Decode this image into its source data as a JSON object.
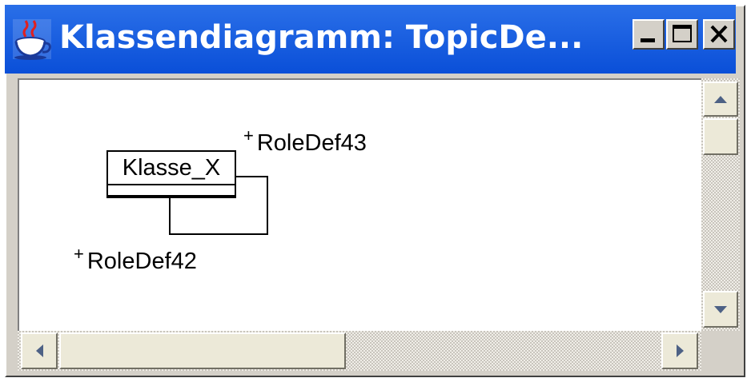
{
  "window": {
    "title": "Klassendiagramm: TopicDe...",
    "app_icon": "java-coffee-cup-icon",
    "controls": [
      "minimize-icon",
      "maximize-icon",
      "close-icon"
    ]
  },
  "diagram": {
    "class": {
      "name": "Klasse_X"
    },
    "roles": [
      {
        "plus": "+",
        "name": "RoleDef43"
      },
      {
        "plus": "+",
        "name": "RoleDef42"
      }
    ]
  },
  "scrollbars": {
    "vertical": {
      "up": "arrow-up-icon",
      "down": "arrow-down-icon"
    },
    "horizontal": {
      "left": "arrow-left-icon",
      "right": "arrow-right-icon"
    }
  },
  "colors": {
    "titlebar": "#0a4fd8",
    "title_text": "#ffffff",
    "frame": "#d4d0c8"
  }
}
